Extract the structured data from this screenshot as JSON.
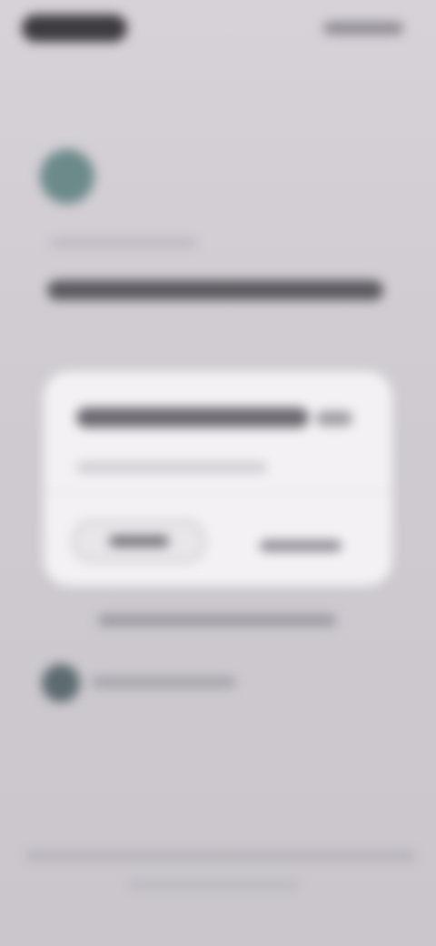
{
  "screen": {
    "state": "blurred",
    "colors": {
      "background_top": "#d7d2d8",
      "background_bottom": "#cac6cc",
      "card": "#f3f1f4",
      "avatar": "#6c8a8a",
      "text_dark": "#5b585e"
    }
  }
}
